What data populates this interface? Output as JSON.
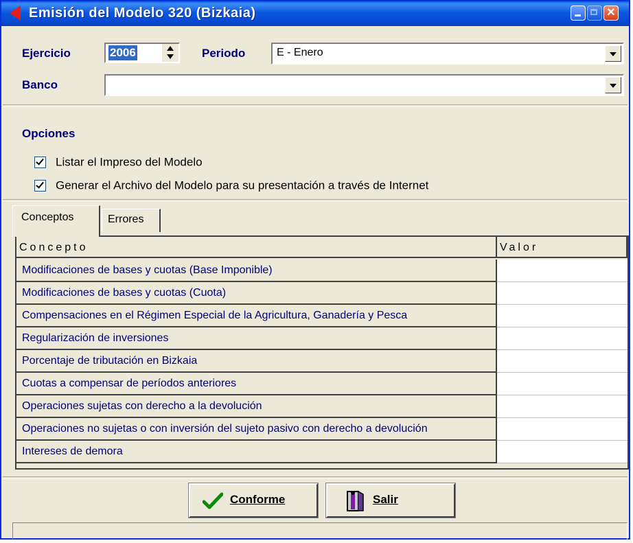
{
  "window": {
    "title": "Emisión del Modelo 320 (Bizkaia)"
  },
  "form": {
    "ejercicio_label": "Ejercicio",
    "ejercicio_value": "2006",
    "periodo_label": "Periodo",
    "periodo_value": "E - Enero",
    "banco_label": "Banco",
    "banco_value": ""
  },
  "options": {
    "heading": "Opciones",
    "items": [
      {
        "label": "Listar el Impreso del Modelo",
        "checked": true
      },
      {
        "label": "Generar el Archivo del Modelo para su presentación a través de Internet",
        "checked": true
      }
    ]
  },
  "tabs": [
    {
      "label": "Conceptos",
      "active": true
    },
    {
      "label": "Errores",
      "active": false
    }
  ],
  "grid": {
    "columns": [
      "Concepto",
      "Valor"
    ],
    "rows": [
      {
        "concepto": "Modificaciones de bases y cuotas (Base Imponible)",
        "valor": ""
      },
      {
        "concepto": "Modificaciones de bases y cuotas (Cuota)",
        "valor": ""
      },
      {
        "concepto": "Compensaciones en el Régimen Especial de la Agricultura, Ganadería y Pesca",
        "valor": ""
      },
      {
        "concepto": "Regularización de inversiones",
        "valor": ""
      },
      {
        "concepto": "Porcentaje de tributación en Bizkaia",
        "valor": ""
      },
      {
        "concepto": "Cuotas a compensar de períodos anteriores",
        "valor": ""
      },
      {
        "concepto": "Operaciones sujetas con derecho a la devolución",
        "valor": ""
      },
      {
        "concepto": "Operaciones no sujetas o con inversión del sujeto pasivo con derecho a devolución",
        "valor": ""
      },
      {
        "concepto": "Intereses de demora",
        "valor": ""
      }
    ]
  },
  "buttons": {
    "conforme_label": "Conforme",
    "salir_label": "Salir"
  },
  "colors": {
    "titlebar": "#0a5fe8",
    "label_blue": "#00007b",
    "checkmark": "#0a8a0a"
  },
  "icons": {
    "app": "red-arrow-icon",
    "conforme": "checkmark-icon",
    "salir": "exit-door-icon"
  }
}
